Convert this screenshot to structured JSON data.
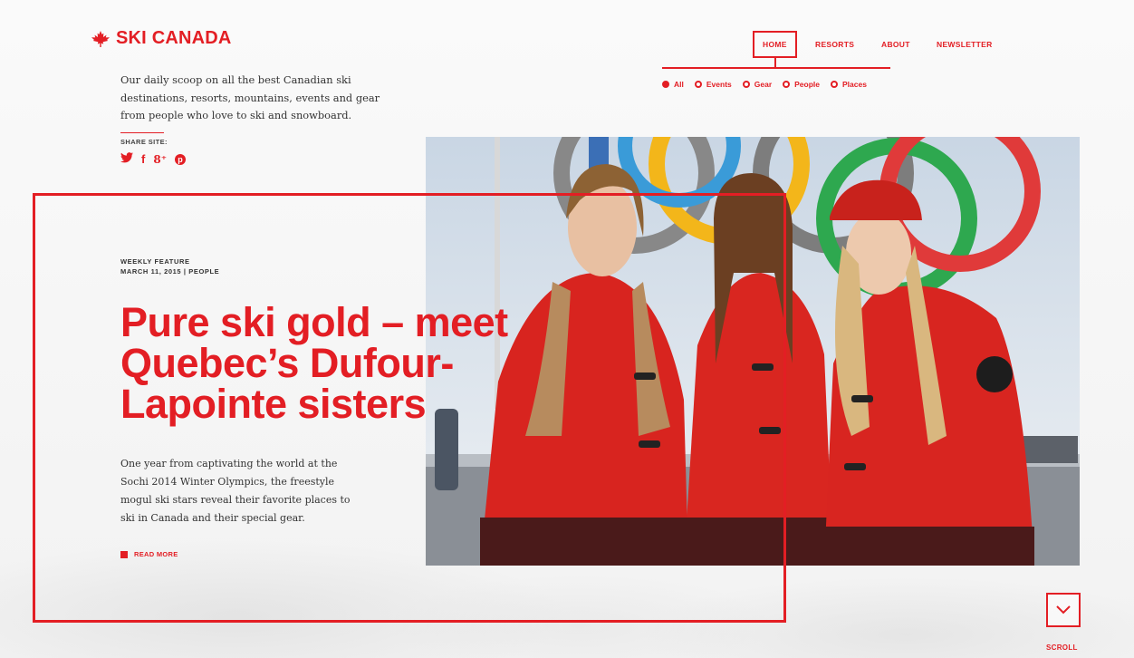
{
  "brand": {
    "name": "SKI CANADA",
    "accent_color": "#e31e24",
    "logo_icon": "maple-leaf-icon"
  },
  "tagline": "Our daily scoop on all the best Canadian ski destinations, resorts, mountains, events and gear from people who love to ski and snowboard.",
  "share": {
    "label": "SHARE SITE:",
    "icons": [
      {
        "name": "twitter-icon",
        "glyph": "🐦"
      },
      {
        "name": "facebook-icon",
        "glyph": "f"
      },
      {
        "name": "google-plus-icon",
        "glyph": "8⁺"
      },
      {
        "name": "pinterest-icon",
        "glyph": "p"
      }
    ]
  },
  "nav": {
    "items": [
      {
        "label": "HOME",
        "active": true
      },
      {
        "label": "RESORTS",
        "active": false
      },
      {
        "label": "ABOUT",
        "active": false
      },
      {
        "label": "NEWSLETTER",
        "active": false
      }
    ],
    "filters": [
      {
        "label": "All",
        "selected": true
      },
      {
        "label": "Events",
        "selected": false
      },
      {
        "label": "Gear",
        "selected": false
      },
      {
        "label": "People",
        "selected": false
      },
      {
        "label": "Places",
        "selected": false
      }
    ]
  },
  "feature": {
    "kicker": "WEEKLY FEATURE",
    "dateline": "MARCH 11, 2015 | PEOPLE",
    "headline_lines": [
      "Pure ski gold – meet",
      "Quebec’s Dufour-",
      "Lapointe sisters"
    ],
    "excerpt": "One year from captivating the world at the Sochi 2014 Winter Olympics, the freestyle mogul ski stars reveal their favorite places to ski in Canada and their special gear.",
    "read_more": "READ MORE"
  },
  "scroll": {
    "label": "SCROLL",
    "icon": "chevron-down-icon"
  }
}
